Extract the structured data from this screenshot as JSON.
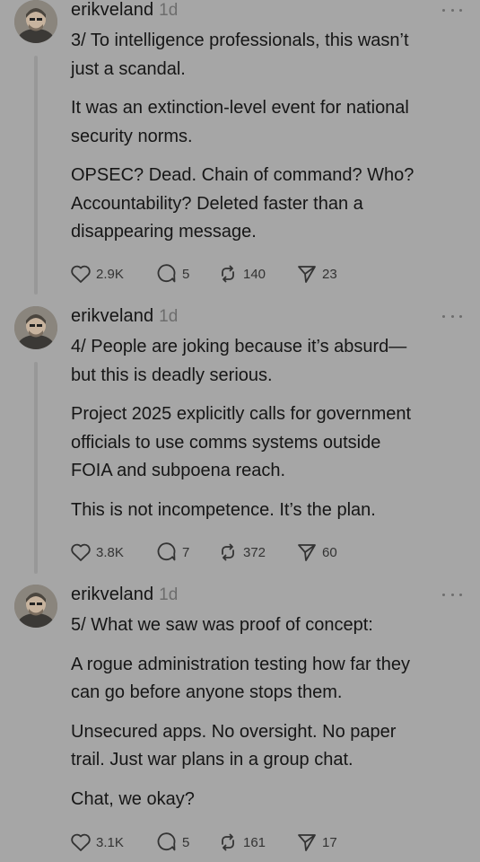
{
  "posts": [
    {
      "username": "erikveland",
      "time": "1d",
      "paragraphs": [
        "3/ To intelligence professionals, this wasn’t\njust a scandal.",
        "It was an extinction-level event for national\nsecurity norms.",
        "OPSEC? Dead. Chain of command? Who?\nAccountability? Deleted faster than a\ndisappearing message."
      ],
      "likes": "2.9K",
      "replies": "5",
      "reposts": "140",
      "shares": "23"
    },
    {
      "username": "erikveland",
      "time": "1d",
      "paragraphs": [
        "4/ People are joking because it’s absurd—\nbut this is deadly serious.",
        "Project 2025 explicitly calls for government\nofficials to use comms systems outside\nFOIA and subpoena reach.",
        "This is not incompetence. It’s the plan."
      ],
      "likes": "3.8K",
      "replies": "7",
      "reposts": "372",
      "shares": "60"
    },
    {
      "username": "erikveland",
      "time": "1d",
      "paragraphs": [
        "5/ What we saw was proof of concept:",
        "A rogue administration testing how far they\ncan go before anyone stops them.",
        "Unsecured apps. No oversight. No paper\ntrail. Just war plans in a group chat.",
        "Chat, we okay?"
      ],
      "likes": "3.1K",
      "replies": "5",
      "reposts": "161",
      "shares": "17"
    }
  ]
}
